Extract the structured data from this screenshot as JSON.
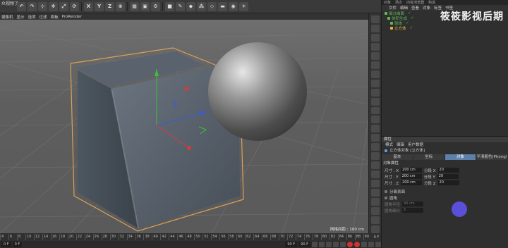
{
  "app": {
    "title": "众视频了"
  },
  "toolbar": {
    "buttons": [
      {
        "name": "undo-icon",
        "glyph": "↶"
      },
      {
        "name": "redo-icon",
        "glyph": "↷"
      },
      {
        "name": "live-select-icon",
        "glyph": "⊹"
      },
      {
        "name": "move-icon",
        "glyph": "✥"
      },
      {
        "name": "scale-icon",
        "glyph": "⤢"
      },
      {
        "name": "rotate-icon",
        "glyph": "⟳"
      },
      {
        "name": "axis-x-button",
        "glyph": "X"
      },
      {
        "name": "axis-y-button",
        "glyph": "Y"
      },
      {
        "name": "axis-z-button",
        "glyph": "Z"
      },
      {
        "name": "coordinate-system-icon",
        "glyph": "⊕"
      },
      {
        "name": "render-view-icon",
        "glyph": "▦"
      },
      {
        "name": "render-picture-icon",
        "glyph": "▣"
      },
      {
        "name": "render-settings-icon",
        "glyph": "⚙"
      },
      {
        "name": "cube-object-icon",
        "glyph": "■"
      },
      {
        "name": "pen-spline-icon",
        "glyph": "✎"
      },
      {
        "name": "subdivision-icon",
        "glyph": "◆"
      },
      {
        "name": "array-icon",
        "glyph": "⁂"
      },
      {
        "name": "deformer-icon",
        "glyph": "◇"
      },
      {
        "name": "floor-icon",
        "glyph": "▬"
      },
      {
        "name": "camera-icon",
        "glyph": "◉"
      },
      {
        "name": "light-icon",
        "glyph": "☀"
      }
    ]
  },
  "viewport_menu": [
    "摄像机",
    "显示",
    "选项",
    "过滤",
    "面板",
    "ProRender"
  ],
  "viewport": {
    "grid_spacing": "网格间距 : 100 cm"
  },
  "timeline": {
    "ticks": [
      "4",
      "6",
      "8",
      "10",
      "12",
      "14",
      "16",
      "18",
      "20",
      "22",
      "24",
      "26",
      "28",
      "30",
      "32",
      "34",
      "36",
      "38",
      "40",
      "42",
      "44",
      "46",
      "48",
      "50",
      "52",
      "54",
      "56",
      "58",
      "60",
      "62",
      "64",
      "66",
      "68",
      "70",
      "72",
      "74",
      "76",
      "78",
      "80",
      "82",
      "84",
      "86",
      "88",
      "90"
    ],
    "end": "0 F"
  },
  "transport": {
    "start_field": "0 F",
    "current_field": "0 F",
    "end_field": "90 F",
    "end_field2": "90 F"
  },
  "object_manager": {
    "tabs": [
      "对象",
      "场次",
      "内容浏览器",
      "构造"
    ],
    "menu": [
      "文件",
      "编辑",
      "查看",
      "对象",
      "标签",
      "书签"
    ],
    "items": [
      {
        "label": "细分曲面",
        "color": "#5fb85a",
        "indent": 0
      },
      {
        "label": "体积生成",
        "color": "#5fb85a",
        "indent": 1
      },
      {
        "label": "球体",
        "color": "#5fb85a",
        "indent": 2
      },
      {
        "label": "立方体",
        "color": "#e0b13e",
        "indent": 2
      }
    ],
    "watermark": "筱筱影视后期"
  },
  "attributes": {
    "header": "属性",
    "menu": [
      "模式",
      "编辑",
      "用户数据"
    ],
    "object_label": "立方体对象 [立方体]",
    "tabs": [
      "基本",
      "坐标",
      "对象",
      "平滑着色(Phong)"
    ],
    "active_tab": "对象",
    "section": "对象属性",
    "rows": [
      {
        "size_label": "尺寸 . X",
        "size_value": "200 cm",
        "seg_label": "分段 X",
        "seg_value": "20"
      },
      {
        "size_label": "尺寸 . Y",
        "size_value": "200 cm",
        "seg_label": "分段 Y",
        "seg_value": "20"
      },
      {
        "size_label": "尺寸 . Z",
        "size_value": "200 cm",
        "seg_label": "分段 Z",
        "seg_value": "20"
      }
    ],
    "separate_surfaces": "分离表面",
    "fillet": "圆角",
    "fillet_radius_label": "圆角半径",
    "fillet_radius_value": "40 cm",
    "fillet_subdiv_label": "圆角细分",
    "fillet_subdiv_value": "5"
  },
  "colors": {
    "accent": "#5d7fa8",
    "cube_outline": "#d9a25a",
    "cursor": "#5a4fd8"
  }
}
